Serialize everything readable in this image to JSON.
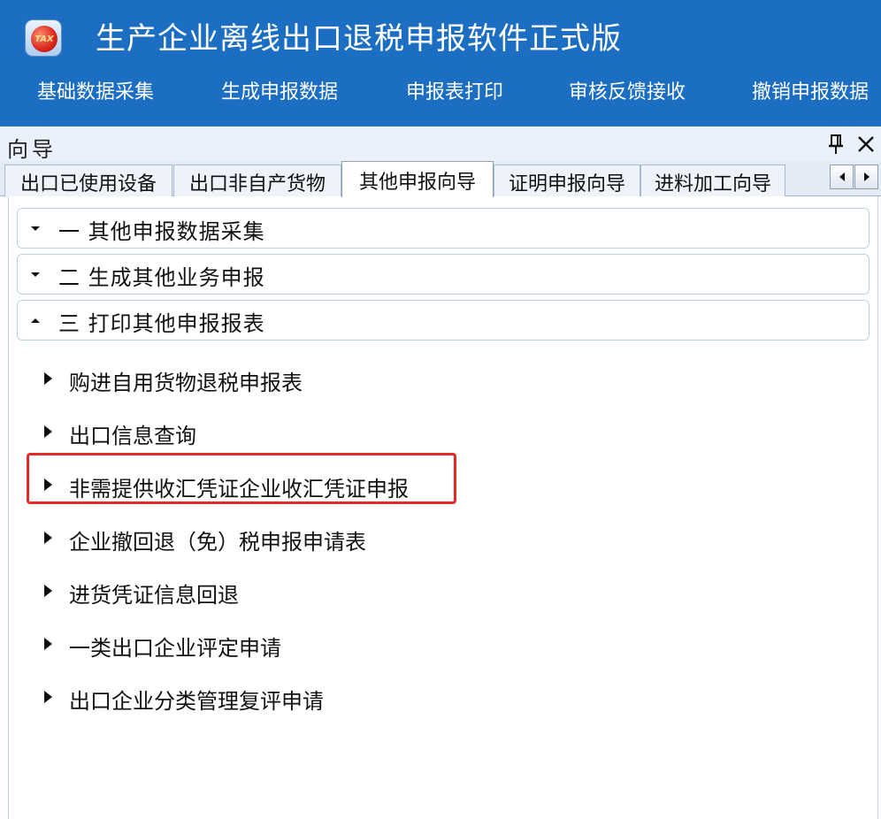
{
  "app": {
    "title": "生产企业离线出口退税申报软件正式版",
    "logo_text": "TAX"
  },
  "menu": [
    {
      "label": "基础数据采集"
    },
    {
      "label": "生成申报数据"
    },
    {
      "label": "申报表打印"
    },
    {
      "label": "审核反馈接收"
    },
    {
      "label": "撤销申报数据"
    }
  ],
  "panel": {
    "title": "向导"
  },
  "tabs": [
    {
      "label": "出口已使用设备"
    },
    {
      "label": "出口非自产货物"
    },
    {
      "label": "其他申报向导",
      "active": true
    },
    {
      "label": "证明申报向导"
    },
    {
      "label": "进料加工向导"
    }
  ],
  "sections": [
    {
      "label": "一  其他申报数据采集",
      "expanded": false
    },
    {
      "label": "二  生成其他业务申报",
      "expanded": false
    },
    {
      "label": "三  打印其他申报报表",
      "expanded": true
    }
  ],
  "items": [
    {
      "label": "购进自用货物退税申报表"
    },
    {
      "label": "出口信息查询"
    },
    {
      "label": "非需提供收汇凭证企业收汇凭证申报",
      "highlighted": true
    },
    {
      "label": "企业撤回退（免）税申报申请表"
    },
    {
      "label": "进货凭证信息回退"
    },
    {
      "label": "一类出口企业评定申请"
    },
    {
      "label": "出口企业分类管理复评申请"
    }
  ],
  "colors": {
    "header_bg": "#1b6ec2",
    "highlight": "#e52a2a"
  }
}
